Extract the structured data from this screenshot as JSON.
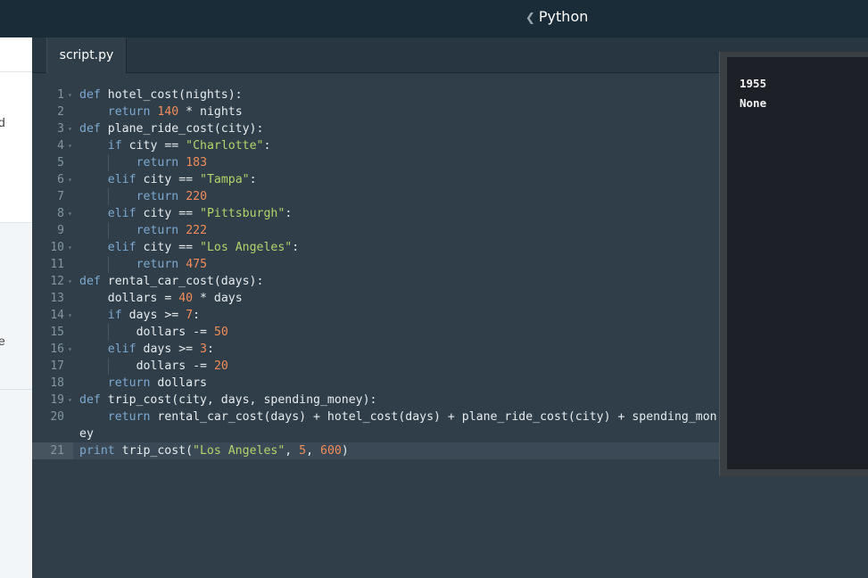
{
  "topbar": {
    "title": "Python",
    "back_glyph": "❮"
  },
  "left_panel": {
    "fragments": [
      "d",
      "e"
    ]
  },
  "tabs": [
    {
      "label": "script.py",
      "active": true
    }
  ],
  "editor": {
    "lines": [
      {
        "n": "1",
        "fold": true,
        "indent": 0,
        "tokens": [
          {
            "t": "kw",
            "v": "def"
          },
          {
            "t": "p",
            "v": " hotel_cost(nights):"
          }
        ]
      },
      {
        "n": "2",
        "fold": false,
        "indent": 1,
        "tokens": [
          {
            "t": "kw",
            "v": "return"
          },
          {
            "t": "p",
            "v": " "
          },
          {
            "t": "num",
            "v": "140"
          },
          {
            "t": "p",
            "v": " * nights"
          }
        ]
      },
      {
        "n": "3",
        "fold": true,
        "indent": 0,
        "tokens": [
          {
            "t": "kw",
            "v": "def"
          },
          {
            "t": "p",
            "v": " plane_ride_cost(city):"
          }
        ]
      },
      {
        "n": "4",
        "fold": true,
        "indent": 1,
        "tokens": [
          {
            "t": "kw",
            "v": "if"
          },
          {
            "t": "p",
            "v": " city == "
          },
          {
            "t": "str",
            "v": "\"Charlotte\""
          },
          {
            "t": "p",
            "v": ":"
          }
        ]
      },
      {
        "n": "5",
        "fold": false,
        "indent": 2,
        "tokens": [
          {
            "t": "kw",
            "v": "return"
          },
          {
            "t": "p",
            "v": " "
          },
          {
            "t": "num",
            "v": "183"
          }
        ]
      },
      {
        "n": "6",
        "fold": true,
        "indent": 1,
        "tokens": [
          {
            "t": "kw",
            "v": "elif"
          },
          {
            "t": "p",
            "v": " city == "
          },
          {
            "t": "str",
            "v": "\"Tampa\""
          },
          {
            "t": "p",
            "v": ":"
          }
        ]
      },
      {
        "n": "7",
        "fold": false,
        "indent": 2,
        "tokens": [
          {
            "t": "kw",
            "v": "return"
          },
          {
            "t": "p",
            "v": " "
          },
          {
            "t": "num",
            "v": "220"
          }
        ]
      },
      {
        "n": "8",
        "fold": true,
        "indent": 1,
        "tokens": [
          {
            "t": "kw",
            "v": "elif"
          },
          {
            "t": "p",
            "v": " city == "
          },
          {
            "t": "str",
            "v": "\"Pittsburgh\""
          },
          {
            "t": "p",
            "v": ":"
          }
        ]
      },
      {
        "n": "9",
        "fold": false,
        "indent": 2,
        "tokens": [
          {
            "t": "kw",
            "v": "return"
          },
          {
            "t": "p",
            "v": " "
          },
          {
            "t": "num",
            "v": "222"
          }
        ]
      },
      {
        "n": "10",
        "fold": true,
        "indent": 1,
        "tokens": [
          {
            "t": "kw",
            "v": "elif"
          },
          {
            "t": "p",
            "v": " city == "
          },
          {
            "t": "str",
            "v": "\"Los Angeles\""
          },
          {
            "t": "p",
            "v": ":"
          }
        ]
      },
      {
        "n": "11",
        "fold": false,
        "indent": 2,
        "tokens": [
          {
            "t": "kw",
            "v": "return"
          },
          {
            "t": "p",
            "v": " "
          },
          {
            "t": "num",
            "v": "475"
          }
        ]
      },
      {
        "n": "12",
        "fold": true,
        "indent": 0,
        "tokens": [
          {
            "t": "kw",
            "v": "def"
          },
          {
            "t": "p",
            "v": " rental_car_cost(days):"
          }
        ]
      },
      {
        "n": "13",
        "fold": false,
        "indent": 1,
        "tokens": [
          {
            "t": "p",
            "v": "dollars = "
          },
          {
            "t": "num",
            "v": "40"
          },
          {
            "t": "p",
            "v": " * days"
          }
        ]
      },
      {
        "n": "14",
        "fold": true,
        "indent": 1,
        "tokens": [
          {
            "t": "kw",
            "v": "if"
          },
          {
            "t": "p",
            "v": " days >= "
          },
          {
            "t": "num",
            "v": "7"
          },
          {
            "t": "p",
            "v": ":"
          }
        ]
      },
      {
        "n": "15",
        "fold": false,
        "indent": 2,
        "tokens": [
          {
            "t": "p",
            "v": "dollars -= "
          },
          {
            "t": "num",
            "v": "50"
          }
        ]
      },
      {
        "n": "16",
        "fold": true,
        "indent": 1,
        "tokens": [
          {
            "t": "kw",
            "v": "elif"
          },
          {
            "t": "p",
            "v": " days >= "
          },
          {
            "t": "num",
            "v": "3"
          },
          {
            "t": "p",
            "v": ":"
          }
        ]
      },
      {
        "n": "17",
        "fold": false,
        "indent": 2,
        "tokens": [
          {
            "t": "p",
            "v": "dollars -= "
          },
          {
            "t": "num",
            "v": "20"
          }
        ]
      },
      {
        "n": "18",
        "fold": false,
        "indent": 1,
        "tokens": [
          {
            "t": "kw",
            "v": "return"
          },
          {
            "t": "p",
            "v": " dollars"
          }
        ]
      },
      {
        "n": "19",
        "fold": true,
        "indent": 0,
        "tokens": [
          {
            "t": "kw",
            "v": "def"
          },
          {
            "t": "p",
            "v": " trip_cost(city, days, spending_money):"
          }
        ]
      },
      {
        "n": "20",
        "fold": false,
        "indent": 1,
        "tokens": [
          {
            "t": "kw",
            "v": "return"
          },
          {
            "t": "p",
            "v": " rental_car_cost(days) + hotel_cost(days) + plane_ride_cost(city) + spending_mon"
          }
        ]
      },
      {
        "n": "",
        "fold": false,
        "indent": 0,
        "tokens": [
          {
            "t": "p",
            "v": "ey"
          }
        ]
      },
      {
        "n": "21",
        "fold": false,
        "indent": 0,
        "active": true,
        "tokens": [
          {
            "t": "kw",
            "v": "print"
          },
          {
            "t": "p",
            "v": " trip_cost("
          },
          {
            "t": "str",
            "v": "\"Los Angeles\""
          },
          {
            "t": "p",
            "v": ", "
          },
          {
            "t": "num",
            "v": "5"
          },
          {
            "t": "p",
            "v": ", "
          },
          {
            "t": "num",
            "v": "600"
          },
          {
            "t": "p",
            "v": ")"
          }
        ]
      }
    ]
  },
  "output": {
    "lines": [
      "1955",
      "None"
    ]
  },
  "colors": {
    "keyword": "#7ea8cf",
    "number": "#f28c5a",
    "string": "#b4d36b",
    "editor_bg": "#2f3e48"
  }
}
